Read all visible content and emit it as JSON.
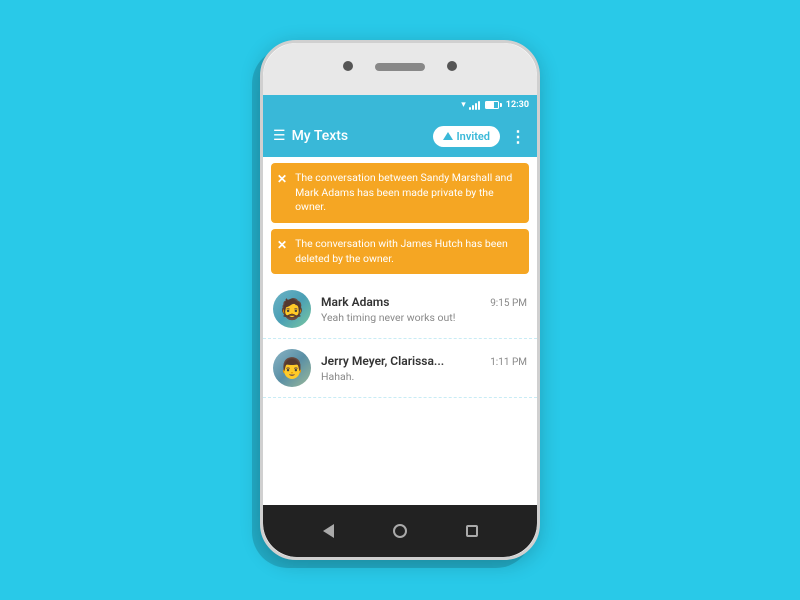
{
  "background_color": "#29C9E8",
  "phone": {
    "status_bar": {
      "time": "12:30",
      "wifi_icon": "▾",
      "signal_icon": "▐",
      "battery_level": 70
    },
    "header": {
      "icon": "☰",
      "title": "My Texts",
      "invited_button": "Invited",
      "more_icon": "⋮"
    },
    "notifications": [
      {
        "id": "notif-1",
        "text": "The conversation between Sandy Marshall and Mark Adams has been made private by the owner."
      },
      {
        "id": "notif-2",
        "text": "The conversation with James Hutch has been deleted by the owner."
      }
    ],
    "conversations": [
      {
        "id": "conv-mark",
        "name": "Mark Adams",
        "time": "9:15 PM",
        "preview": "Yeah timing never works out!",
        "avatar_label": "Mark Adams avatar"
      },
      {
        "id": "conv-jerry",
        "name": "Jerry Meyer, Clarissa...",
        "time": "1:11 PM",
        "preview": "Hahah.",
        "avatar_label": "Jerry Meyer avatar"
      }
    ],
    "nav": {
      "back": "back",
      "home": "home",
      "recents": "recents"
    }
  }
}
